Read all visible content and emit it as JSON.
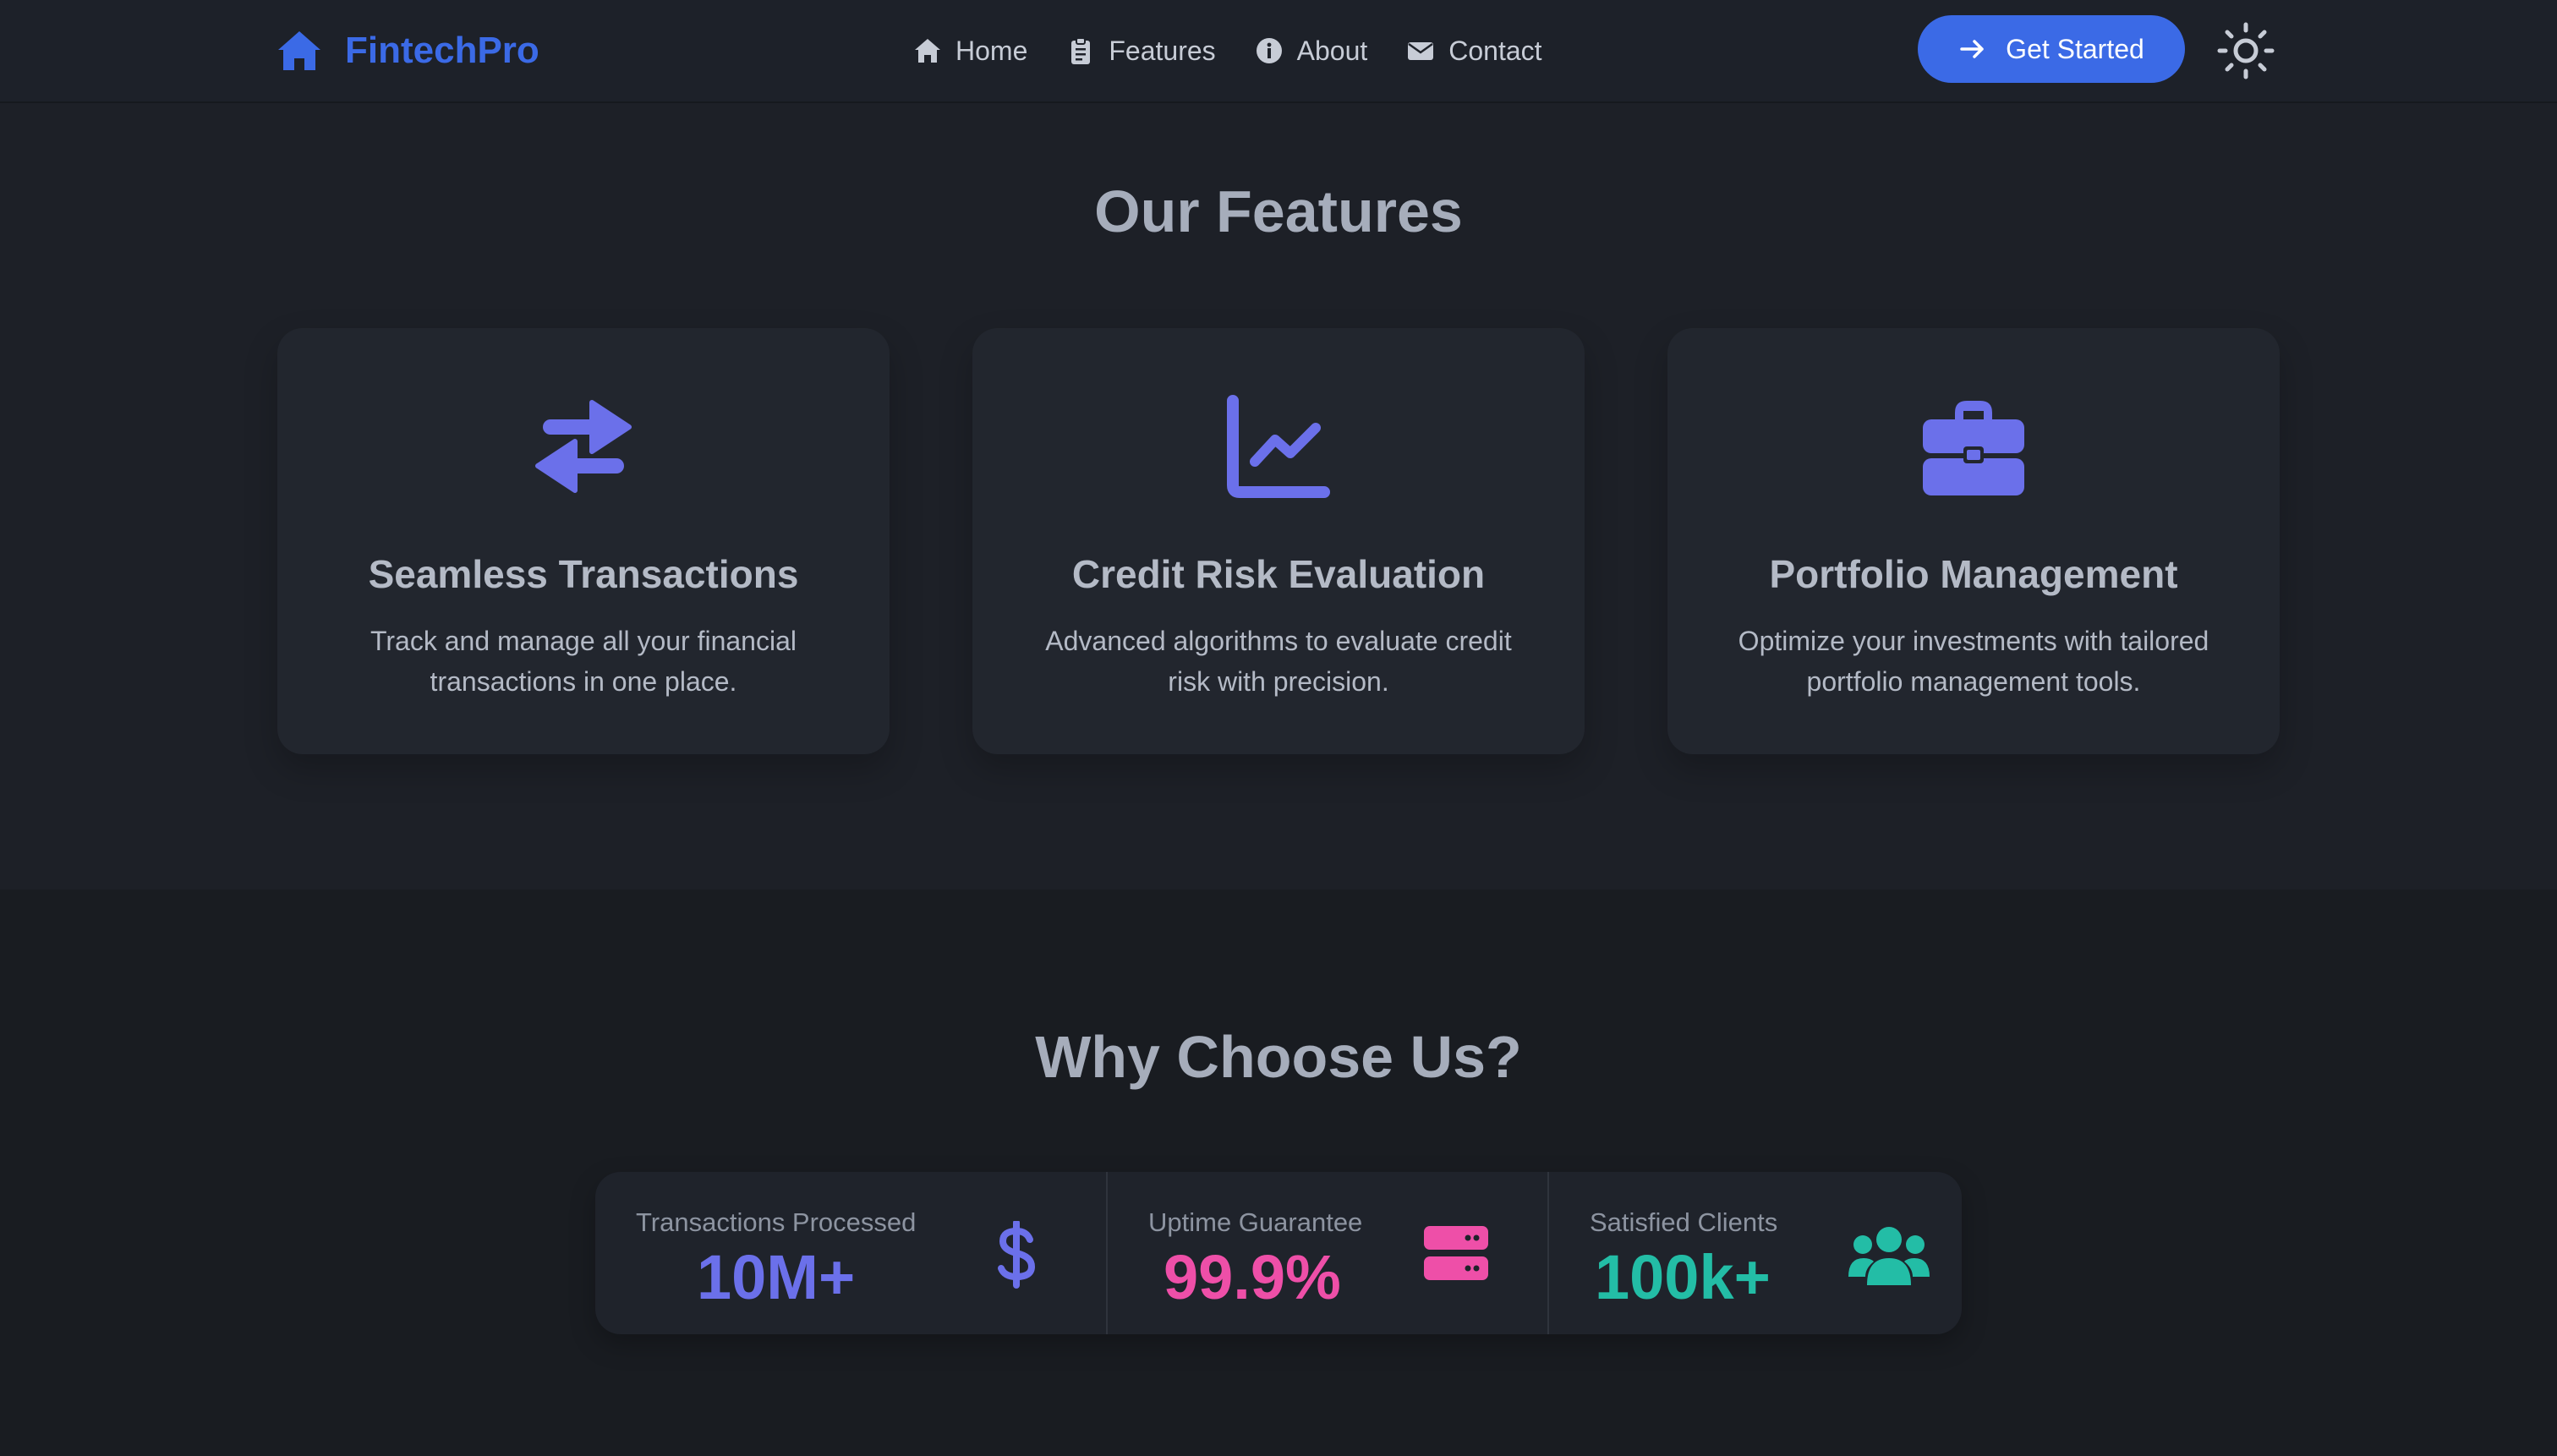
{
  "nav": {
    "brand": "FintechPro",
    "links": [
      {
        "label": "Home",
        "icon": "home-icon"
      },
      {
        "label": "Features",
        "icon": "clipboard-icon"
      },
      {
        "label": "About",
        "icon": "info-icon"
      },
      {
        "label": "Contact",
        "icon": "envelope-icon"
      }
    ],
    "cta_label": "Get Started",
    "theme_icon": "sun-icon"
  },
  "features": {
    "title": "Our Features",
    "cards": [
      {
        "icon": "exchange-arrows-icon",
        "title": "Seamless Transactions",
        "description": "Track and manage all your financial transactions in one place."
      },
      {
        "icon": "line-chart-icon",
        "title": "Credit Risk Evaluation",
        "description": "Advanced algorithms to evaluate credit risk with precision."
      },
      {
        "icon": "briefcase-icon",
        "title": "Portfolio Management",
        "description": "Optimize your investments with tailored portfolio management tools."
      }
    ]
  },
  "why": {
    "title": "Why Choose Us?",
    "stats": [
      {
        "title": "Transactions Processed",
        "value": "10M+",
        "icon": "dollar-icon",
        "color": "#6b70ea"
      },
      {
        "title": "Uptime Guarantee",
        "value": "99.9%",
        "icon": "server-icon",
        "color": "#ee4fa8"
      },
      {
        "title": "Satisfied Clients",
        "value": "100k+",
        "icon": "users-icon",
        "color": "#23bda6"
      }
    ]
  },
  "colors": {
    "brand": "#3b6ae6",
    "accent_icon": "#6b70ea",
    "background": "#191c21",
    "card": "#22262e"
  }
}
